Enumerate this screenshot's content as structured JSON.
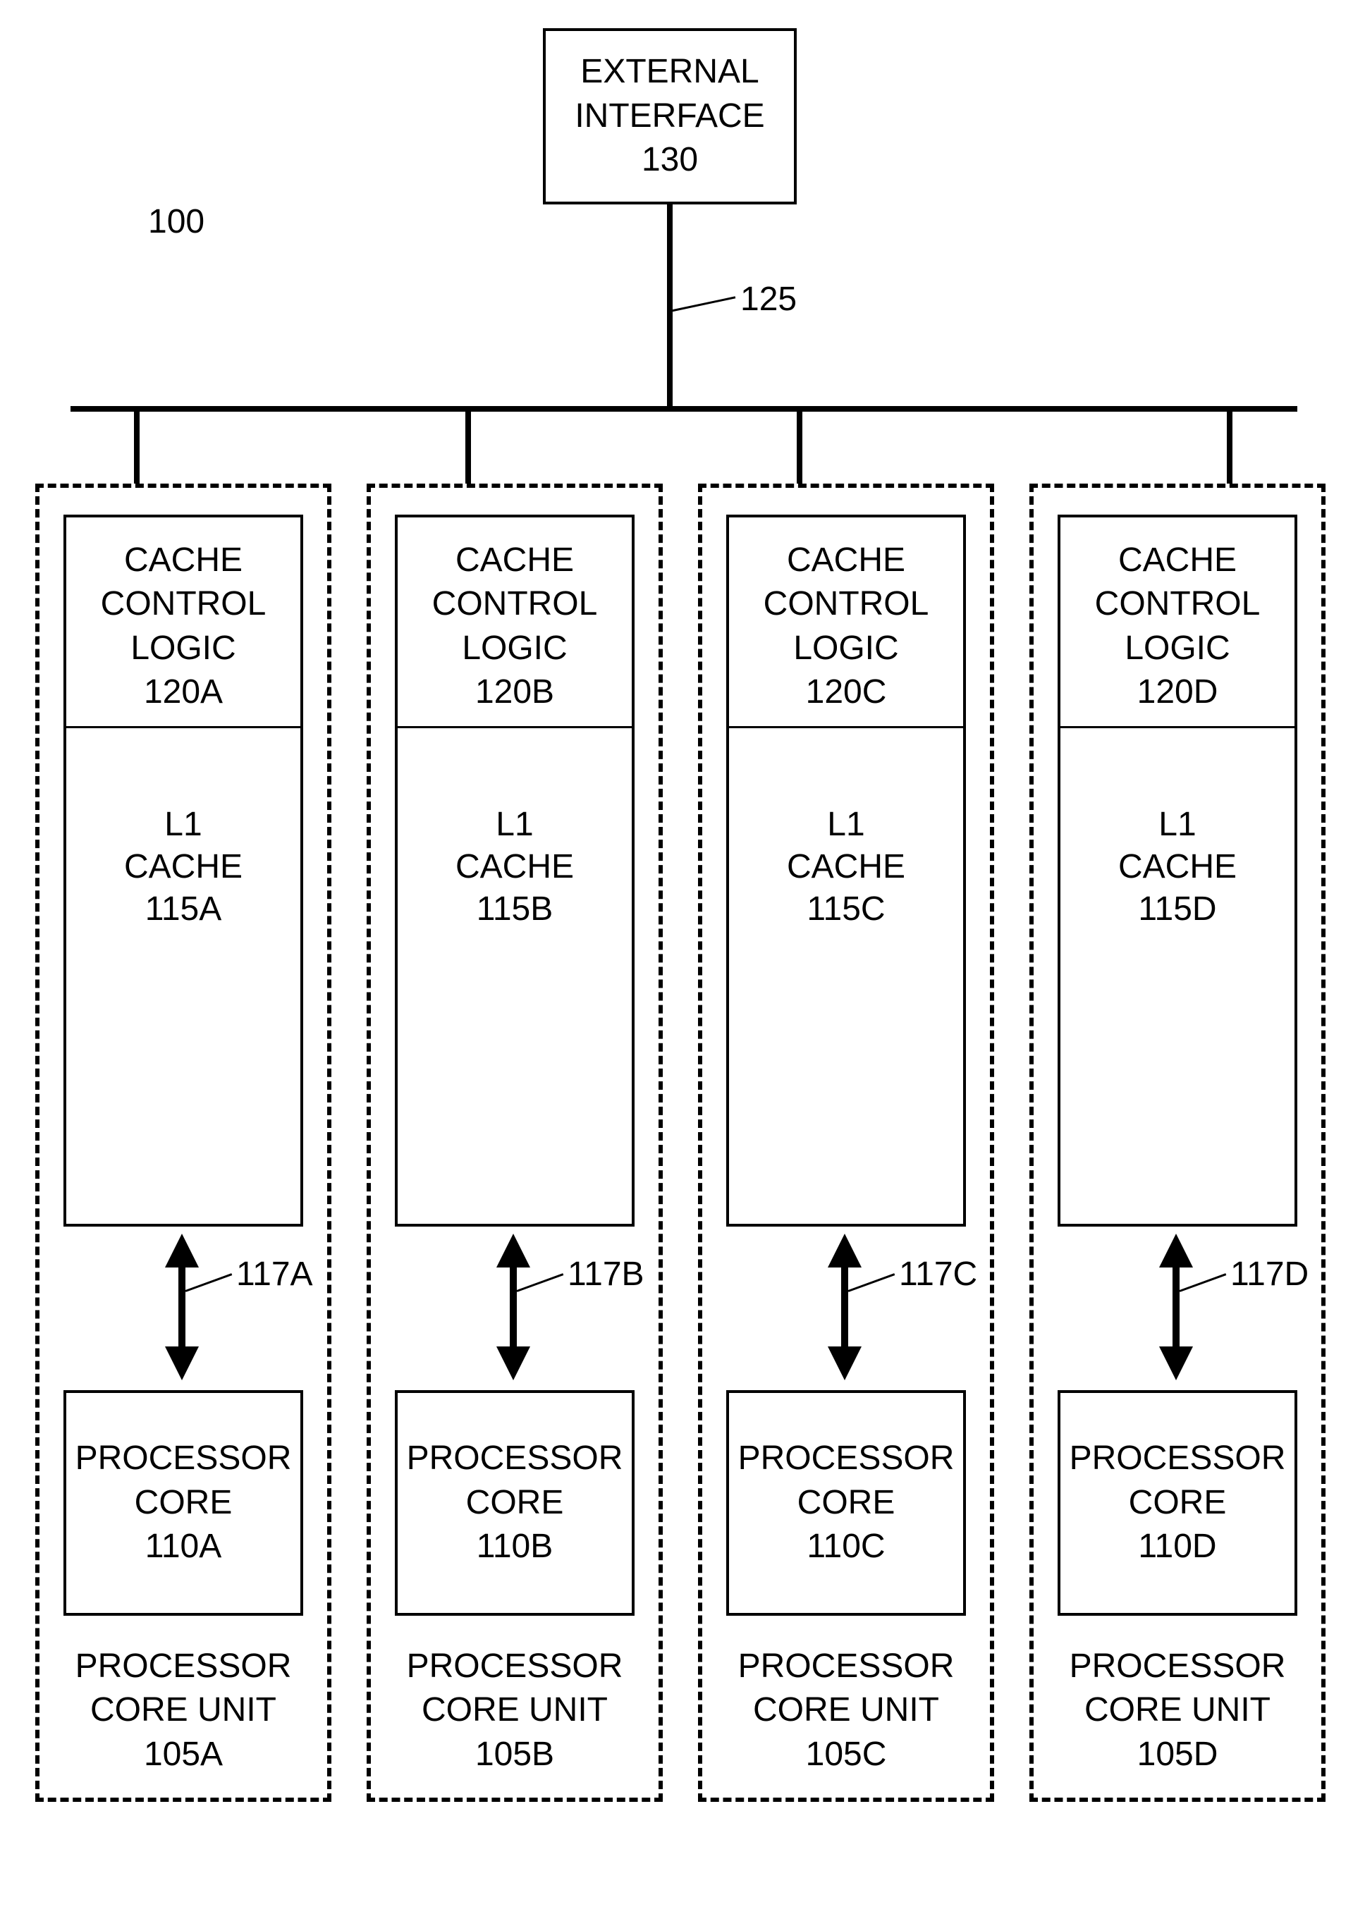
{
  "diagram_number": "100",
  "external_interface": {
    "line1": "EXTERNAL",
    "line2": "INTERFACE",
    "ref": "130"
  },
  "bus_label": "125",
  "cores": [
    {
      "ccl": {
        "line1": "CACHE",
        "line2": "CONTROL",
        "line3": "LOGIC",
        "ref": "120A"
      },
      "l1": {
        "line1": "L1",
        "line2": "CACHE",
        "ref": "115A"
      },
      "arrow_ref": "117A",
      "proc": {
        "line1": "PROCESSOR",
        "line2": "CORE",
        "ref": "110A"
      },
      "unit": {
        "line1": "PROCESSOR",
        "line2": "CORE UNIT",
        "ref": "105A"
      }
    },
    {
      "ccl": {
        "line1": "CACHE",
        "line2": "CONTROL",
        "line3": "LOGIC",
        "ref": "120B"
      },
      "l1": {
        "line1": "L1",
        "line2": "CACHE",
        "ref": "115B"
      },
      "arrow_ref": "117B",
      "proc": {
        "line1": "PROCESSOR",
        "line2": "CORE",
        "ref": "110B"
      },
      "unit": {
        "line1": "PROCESSOR",
        "line2": "CORE UNIT",
        "ref": "105B"
      }
    },
    {
      "ccl": {
        "line1": "CACHE",
        "line2": "CONTROL",
        "line3": "LOGIC",
        "ref": "120C"
      },
      "l1": {
        "line1": "L1",
        "line2": "CACHE",
        "ref": "115C"
      },
      "arrow_ref": "117C",
      "proc": {
        "line1": "PROCESSOR",
        "line2": "CORE",
        "ref": "110C"
      },
      "unit": {
        "line1": "PROCESSOR",
        "line2": "CORE UNIT",
        "ref": "105C"
      }
    },
    {
      "ccl": {
        "line1": "CACHE",
        "line2": "CONTROL",
        "line3": "LOGIC",
        "ref": "120D"
      },
      "l1": {
        "line1": "L1",
        "line2": "CACHE",
        "ref": "115D"
      },
      "arrow_ref": "117D",
      "proc": {
        "line1": "PROCESSOR",
        "line2": "CORE",
        "ref": "110D"
      },
      "unit": {
        "line1": "PROCESSOR",
        "line2": "CORE UNIT",
        "ref": "105D"
      }
    }
  ]
}
